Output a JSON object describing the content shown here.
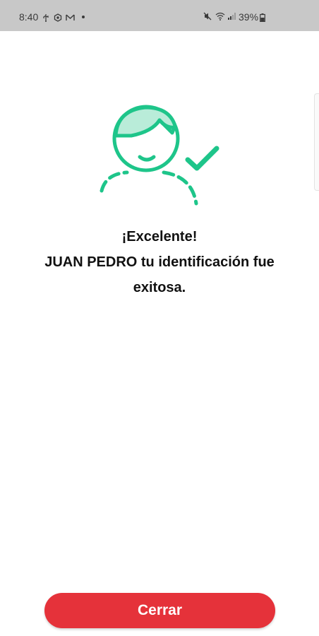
{
  "status_bar": {
    "time": "8:40",
    "battery": "39%",
    "left_icons": [
      "usb-icon",
      "settings-hex-icon",
      "gmail-icon",
      "notification-dot"
    ],
    "right_icons": [
      "mute-icon",
      "wifi-icon",
      "signal-icon",
      "battery-icon"
    ]
  },
  "illustration": {
    "icon": "user-verified-icon",
    "accent_color": "#1ec58a",
    "fill_color": "#b9ecd9"
  },
  "message": {
    "title": "¡Excelente!",
    "line1": "JUAN PEDRO tu identificación fue",
    "line2": "exitosa."
  },
  "actions": {
    "close_label": "Cerrar",
    "close_color": "#e5323a"
  }
}
